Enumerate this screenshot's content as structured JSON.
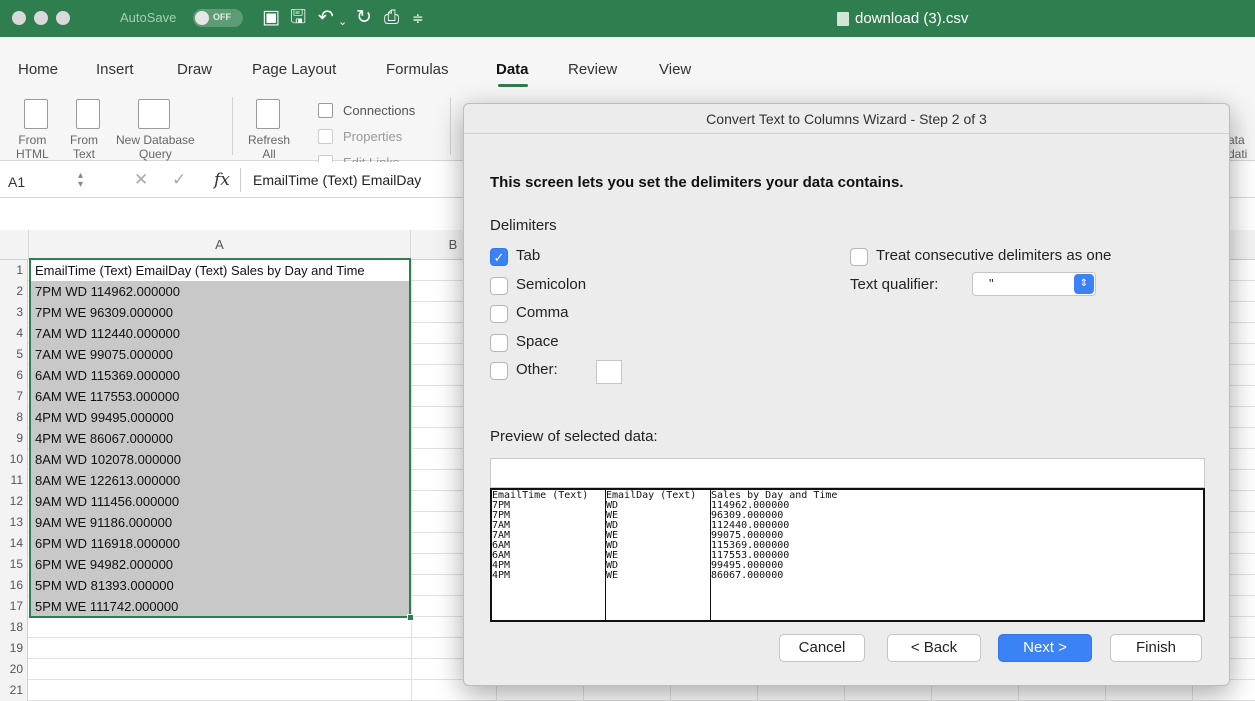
{
  "window": {
    "autosave_label": "AutoSave",
    "autosave_state": "OFF",
    "document_title": "download (3).csv"
  },
  "tabs": [
    "Home",
    "Insert",
    "Draw",
    "Page Layout",
    "Formulas",
    "Data",
    "Review",
    "View"
  ],
  "active_tab": "Data",
  "ribbon": {
    "from_html": "From\nHTML",
    "from_text": "From\nText",
    "new_db_query": "New Database\nQuery",
    "refresh_all": "Refresh\nAll",
    "connections": "Connections",
    "properties": "Properties",
    "edit_links": "Edit Links",
    "partial_right": "ata\ndati"
  },
  "formula_bar": {
    "name_box": "A1",
    "fx": "fx",
    "content": "EmailTime (Text)  EmailDay"
  },
  "sheet": {
    "columns": [
      "A",
      "B"
    ],
    "row_numbers": [
      "1",
      "2",
      "3",
      "4",
      "5",
      "6",
      "7",
      "8",
      "9",
      "10",
      "11",
      "12",
      "13",
      "14",
      "15",
      "16",
      "17",
      "18",
      "19",
      "20",
      "21"
    ],
    "column_a": [
      "EmailTime (Text) EmailDay (Text) Sales by Day and Time",
      "7PM WD 114962.000000",
      "7PM WE 96309.000000",
      "7AM WD 112440.000000",
      "7AM WE 99075.000000",
      "6AM WD 115369.000000",
      "6AM WE 117553.000000",
      "4PM WD 99495.000000",
      "4PM WE 86067.000000",
      "8AM WD 102078.000000",
      "8AM WE 122613.000000",
      "9AM WD 111456.000000",
      "9AM WE 91186.000000",
      "6PM WD 116918.000000",
      "6PM WE 94982.000000",
      "5PM WD 81393.000000",
      "5PM WE 111742.000000",
      "",
      "",
      "",
      ""
    ]
  },
  "dialog": {
    "title": "Convert Text to Columns Wizard - Step 2 of 3",
    "heading": "This screen lets you set the delimiters your data contains.",
    "delimiters_label": "Delimiters",
    "delimiters": [
      {
        "label": "Tab",
        "checked": true
      },
      {
        "label": "Semicolon",
        "checked": false
      },
      {
        "label": "Comma",
        "checked": false
      },
      {
        "label": "Space",
        "checked": false
      },
      {
        "label": "Other:",
        "checked": false
      }
    ],
    "treat_consecutive": "Treat consecutive delimiters as one",
    "text_qualifier_label": "Text qualifier:",
    "text_qualifier_value": "\"",
    "preview_label": "Preview of selected data:",
    "preview_columns": [
      [
        "EmailTime (Text)",
        "7PM",
        "7PM",
        "7AM",
        "7AM",
        "6AM",
        "6AM",
        "4PM",
        "4PM"
      ],
      [
        "EmailDay (Text)",
        "WD",
        "WE",
        "WD",
        "WE",
        "WD",
        "WE",
        "WD",
        "WE"
      ],
      [
        "Sales by Day and Time",
        "114962.000000",
        "96309.000000",
        "112440.000000",
        "99075.000000",
        "115369.000000",
        "117553.000000",
        "99495.000000",
        "86067.000000"
      ]
    ],
    "buttons": {
      "cancel": "Cancel",
      "back": "< Back",
      "next": "Next >",
      "finish": "Finish"
    }
  }
}
